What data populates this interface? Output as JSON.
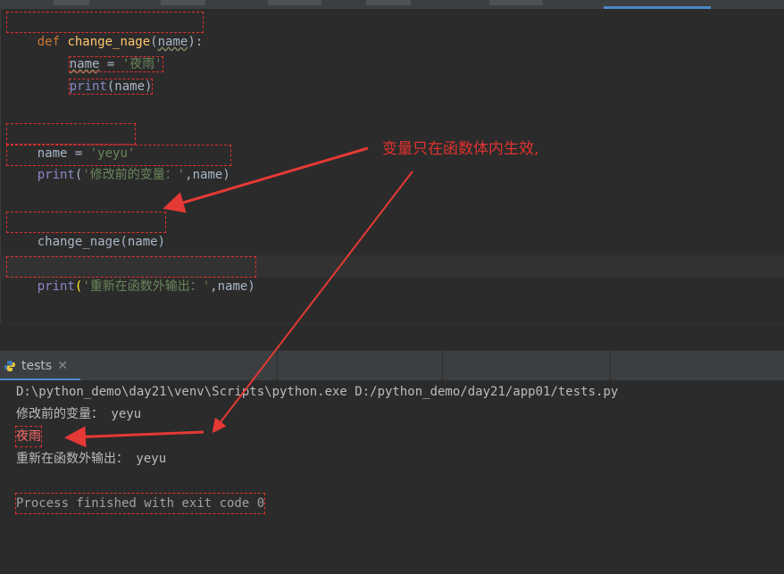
{
  "editor": {
    "lines": {
      "def_kw": "def",
      "func_name": "change_nage",
      "open_paren": "(",
      "param": "name",
      "close_colon": "):",
      "assign_var": "name",
      "assign_eq": " = ",
      "assign_str": "'夜雨'",
      "print_kw": "print",
      "print_arg": "(name)",
      "global_var": "name",
      "global_eq": " = ",
      "global_str": "'yeyu'",
      "print2_kw": "print",
      "print2_open": "(",
      "print2_str": "'修改前的变量：'",
      "print2_rest": ",name)",
      "call_line": "change_nage(name)",
      "print3_kw": "print",
      "print3_open": "(",
      "print3_str": "'重新在函数外输出：'",
      "print3_rest": ",name)"
    }
  },
  "annotation": {
    "text": "变量只在函数体内生效,"
  },
  "run": {
    "tab_label": "tests",
    "tab_close": "✕",
    "icon": "python-icon"
  },
  "console": {
    "lines": [
      "D:\\python_demo\\day21\\venv\\Scripts\\python.exe D:/python_demo/day21/app01/tests.py",
      "修改前的变量： yeyu",
      "夜雨",
      "重新在函数外输出： yeyu",
      "",
      "Process finished with exit code 0"
    ]
  },
  "colors": {
    "editor_bg": "#2b2b2b",
    "keyword": "#cc7832",
    "function": "#ffc66d",
    "string": "#6a8759",
    "builtin": "#8888c6",
    "annotation": "#e0312f",
    "console_text": "#bbbbbb"
  }
}
